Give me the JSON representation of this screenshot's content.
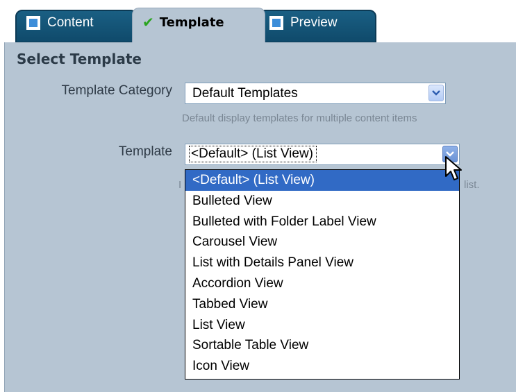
{
  "tabs": [
    {
      "label": "Content",
      "icon": "square-icon",
      "state": "inactive"
    },
    {
      "label": "Template",
      "icon": "checkmark-icon",
      "state": "active"
    },
    {
      "label": "Preview",
      "icon": "square-icon",
      "state": "inactive"
    }
  ],
  "section_title": "Select Template",
  "template_category": {
    "label": "Template Category",
    "value": "Default Templates",
    "hint": "Default display templates for multiple content items"
  },
  "template": {
    "label": "Template",
    "value": "<Default> (List View)",
    "hint_start": "I",
    "hint_end": "list."
  },
  "dropdown_options": [
    "<Default> (List View)",
    "Bulleted View",
    "Bulleted with Folder Label View",
    "Carousel View",
    "List with Details Panel View",
    "Accordion View",
    "Tabbed View",
    "List View",
    "Sortable Table View",
    "Icon View"
  ],
  "selected_option_index": 0,
  "colors": {
    "panel": "#b6c5d3",
    "tab_inactive": "#15557a",
    "selection": "#316ac5",
    "check": "#2aa41f"
  }
}
